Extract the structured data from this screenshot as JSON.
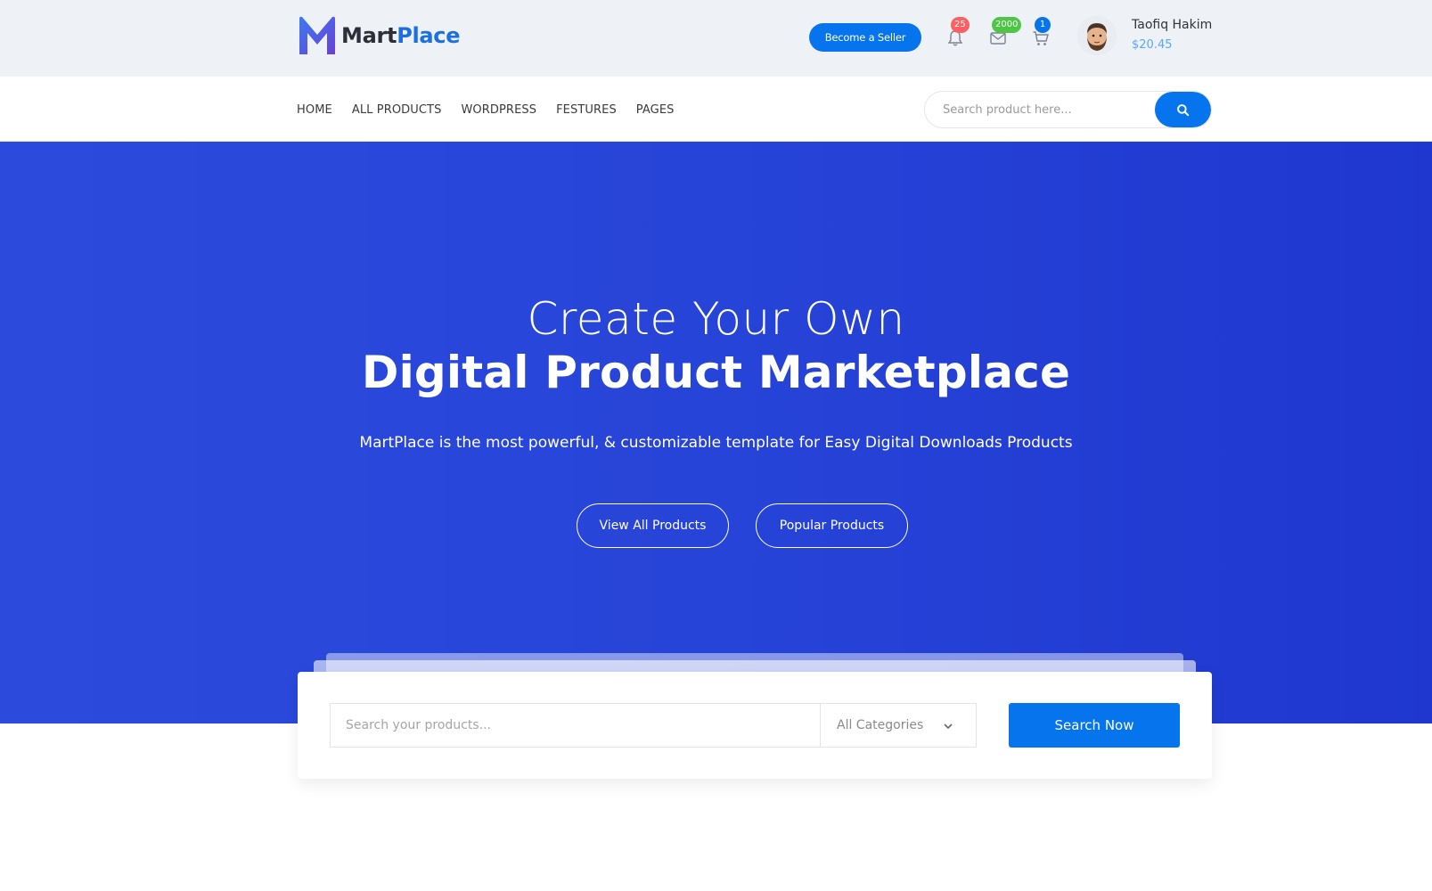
{
  "header": {
    "logo": {
      "part_a": "Mart",
      "part_b": "Place"
    },
    "become_seller": "Become a Seller",
    "notifications": {
      "icon": "bell-icon",
      "count": "25"
    },
    "messages": {
      "icon": "envelope-icon",
      "count": "2000"
    },
    "cart": {
      "icon": "cart-icon",
      "count": "1"
    },
    "user": {
      "name": "Taofiq Hakim",
      "balance": "$20.45"
    }
  },
  "nav": {
    "items": [
      "HOME",
      "ALL PRODUCTS",
      "WORDPRESS",
      "FESTURES",
      "PAGES"
    ],
    "search_placeholder": "Search product here..."
  },
  "hero": {
    "title_line1": "Create Your Own",
    "title_line2": "Digital Product Marketplace",
    "subtitle": "MartPlace is the most powerful, & customizable template for Easy Digital Downloads Products",
    "btn_all": "View All Products",
    "btn_popular": "Popular Products"
  },
  "search_panel": {
    "placeholder": "Search your products...",
    "category": "All Categories",
    "button": "Search Now"
  },
  "colors": {
    "accent": "#0674ec",
    "hero": "#2744d8",
    "badge_red": "#ff5e62",
    "badge_green": "#4cc644"
  }
}
